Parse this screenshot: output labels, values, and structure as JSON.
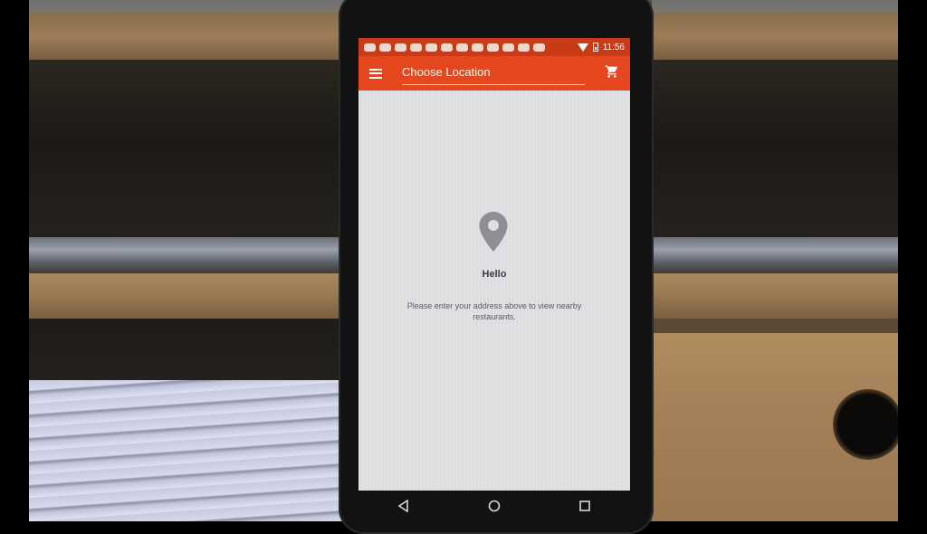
{
  "status_bar": {
    "notification_icons": [
      "notification-icon",
      "notification-icon",
      "notification-icon",
      "notification-icon",
      "notification-icon",
      "notification-icon",
      "notification-icon",
      "notification-icon",
      "notification-icon",
      "notification-icon",
      "notification-icon",
      "notification-icon"
    ],
    "time": "11:56"
  },
  "app_bar": {
    "location_placeholder": "Choose Location",
    "menu_icon": "menu-icon",
    "cart_icon": "cart-icon"
  },
  "empty_state": {
    "icon": "location-pin-icon",
    "title": "Hello",
    "message": "Please enter your address above to view nearby restaurants."
  },
  "colors": {
    "status_bar": "#c93a17",
    "app_bar": "#e5471e",
    "content_bg": "#dfe0e2",
    "pin": "#8e8f94",
    "title_text": "#3d3e45"
  }
}
